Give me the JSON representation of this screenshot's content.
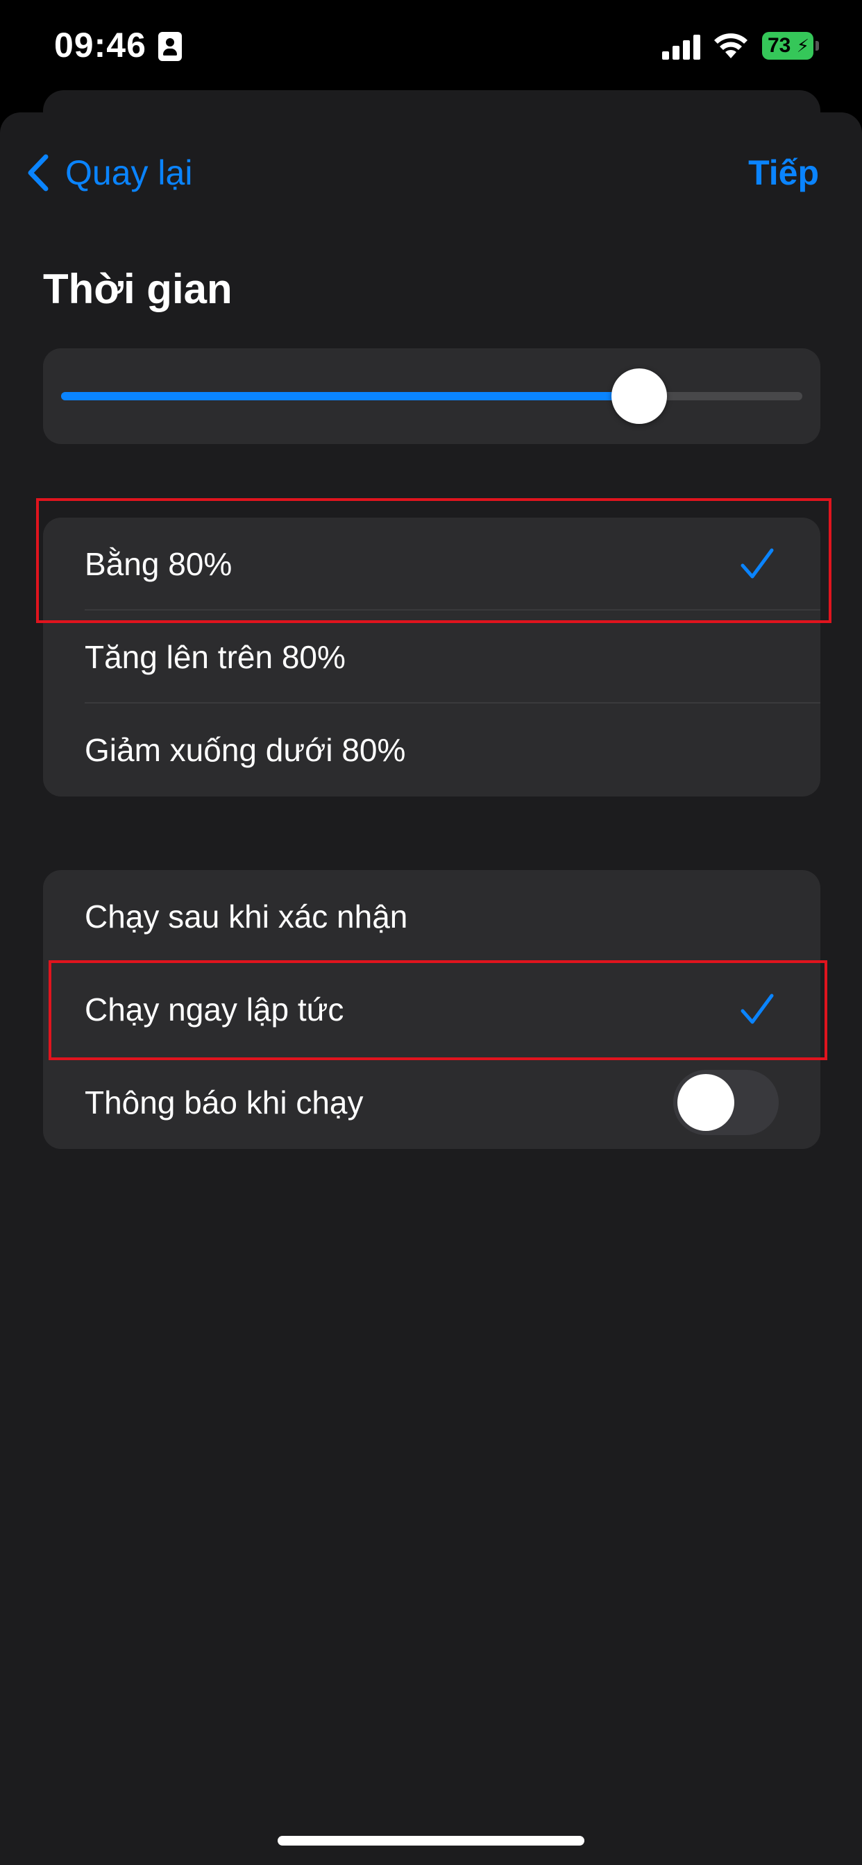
{
  "status_bar": {
    "time": "09:46",
    "battery_percent": "73"
  },
  "nav": {
    "back_label": "Quay lại",
    "next_label": "Tiếp"
  },
  "section_title": "Thời gian",
  "slider": {
    "value_fraction": 0.78
  },
  "condition_options": [
    {
      "label": "Bằng 80%",
      "selected": true
    },
    {
      "label": "Tăng lên trên 80%",
      "selected": false
    },
    {
      "label": "Giảm xuống dưới 80%",
      "selected": false
    }
  ],
  "run_options": [
    {
      "label": "Chạy sau khi xác nhận",
      "selected": false
    },
    {
      "label": "Chạy ngay lập tức",
      "selected": true
    }
  ],
  "notify_toggle": {
    "label": "Thông báo khi chạy",
    "on": false
  },
  "colors": {
    "accent": "#0a84ff",
    "highlight": "#e0141e",
    "background": "#1c1c1e",
    "card": "#2c2c2e"
  }
}
